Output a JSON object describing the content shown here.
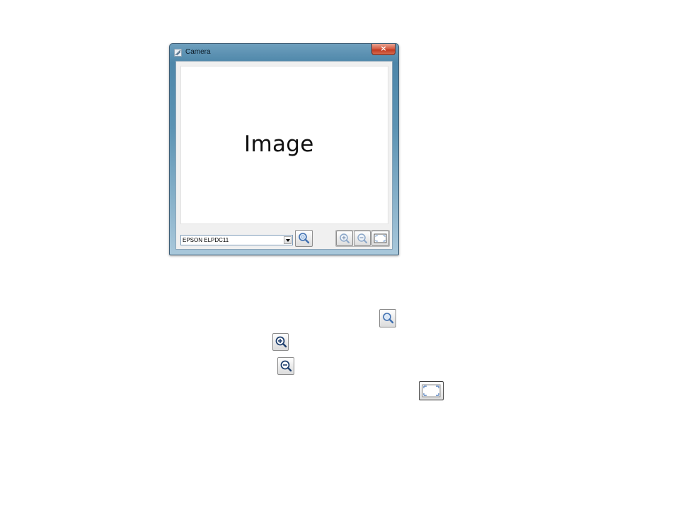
{
  "window": {
    "title": "Camera",
    "close_label": "×",
    "image_placeholder": "Image"
  },
  "toolbar": {
    "device_selected": "EPSON ELPDC11",
    "buttons": [
      "search-camera-icon",
      "zoom-in-icon",
      "zoom-out-icon",
      "fit-to-window-icon"
    ]
  },
  "legend_icons": [
    "search-camera-icon",
    "zoom-in-icon",
    "zoom-out-icon",
    "fit-to-window-icon"
  ],
  "colors": {
    "titlebar": "#5c93b3",
    "close_button": "#c0391f",
    "magnifier": "#3f6fb0"
  }
}
